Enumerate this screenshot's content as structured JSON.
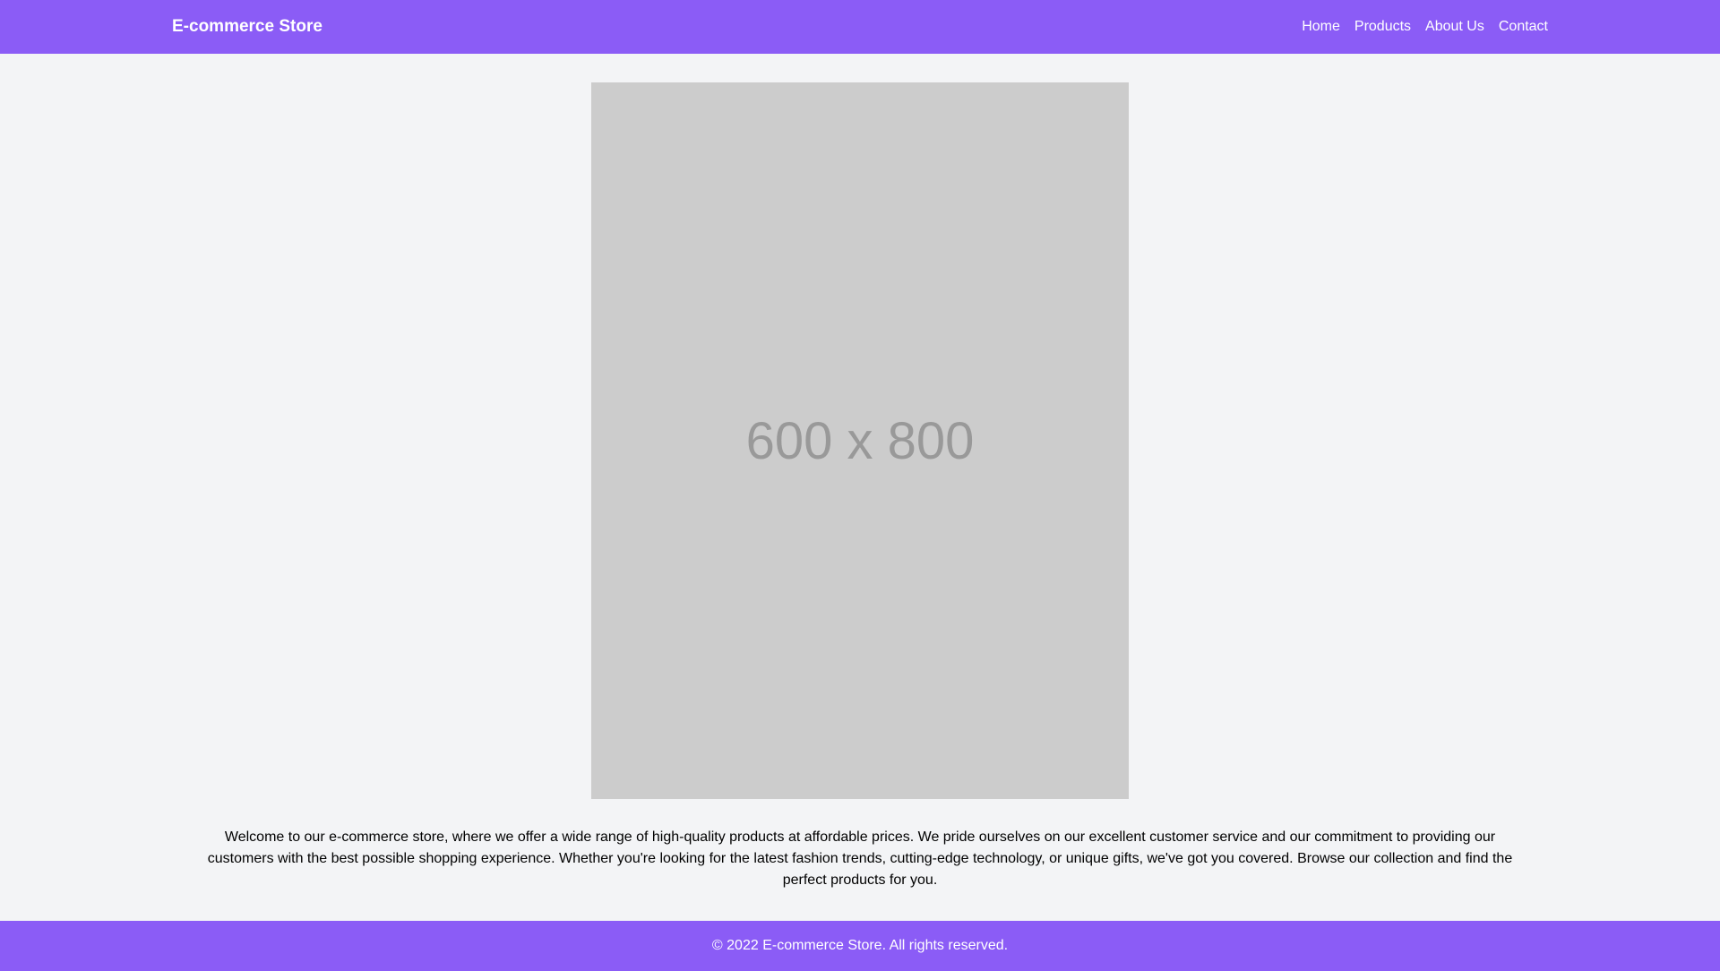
{
  "header": {
    "brand": "E-commerce Store",
    "nav": [
      {
        "label": "Home"
      },
      {
        "label": "Products"
      },
      {
        "label": "About Us"
      },
      {
        "label": "Contact"
      }
    ]
  },
  "hero": {
    "placeholder_text": "600 x 800"
  },
  "main": {
    "intro": "Welcome to our e-commerce store, where we offer a wide range of high-quality products at affordable prices. We pride ourselves on our excellent customer service and our commitment to providing our customers with the best possible shopping experience. Whether you're looking for the latest fashion trends, cutting-edge technology, or unique gifts, we've got you covered. Browse our collection and find the perfect products for you."
  },
  "footer": {
    "copyright": "© 2022 E-commerce Store. All rights reserved."
  },
  "colors": {
    "accent": "#8b5cf6",
    "background": "#f3f4f6",
    "placeholder_bg": "#cccccc",
    "placeholder_text": "#999999"
  }
}
